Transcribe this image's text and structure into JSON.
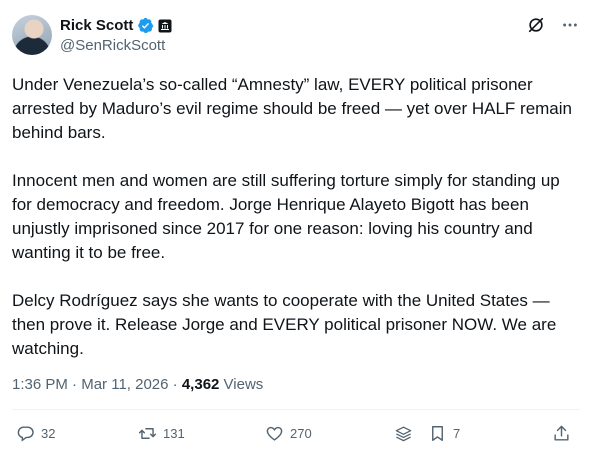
{
  "author": {
    "name": "Rick Scott",
    "handle": "@SenRickScott"
  },
  "tweet": {
    "paragraphs": [
      "Under Venezuela’s so-called “Amnesty” law, EVERY political prisoner arrested by Maduro’s evil regime should be freed — yet over HALF remain behind bars.",
      "Innocent men and women are still suffering torture simply for standing up for democracy and freedom. Jorge Henrique Alayeto Bigott has been unjustly imprisoned since 2017 for one reason: loving his country and wanting it to be free.",
      "Delcy Rodríguez says she wants to cooperate with the United States — then prove it. Release Jorge and EVERY political prisoner NOW. We are watching."
    ],
    "time": "1:36 PM",
    "separator1": " · ",
    "date": "Mar 11, 2026",
    "separator2": " · ",
    "views_count": "4,362",
    "views_label": " Views"
  },
  "actions": {
    "replies": "32",
    "reposts": "131",
    "likes": "270",
    "bookmarks": "7"
  },
  "colors": {
    "text": "#0f1419",
    "secondary": "#536471",
    "verified": "#1d9bf0"
  }
}
